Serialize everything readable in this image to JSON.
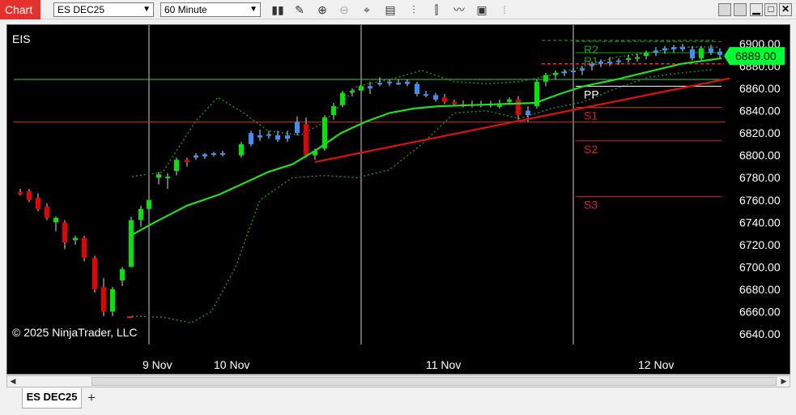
{
  "toolbar": {
    "chart_label": "Chart",
    "instrument": "ES DEC25",
    "interval": "60 Minute",
    "icons": [
      "bar-type-icon",
      "draw-pencil-icon",
      "zoom-in-icon",
      "zoom-out-icon",
      "crosshair-icon",
      "properties-icon",
      "indicators-icon",
      "strategies-icon",
      "drawing-tools-icon",
      "snapshot-icon"
    ]
  },
  "chart": {
    "symbol": "EIS",
    "copyright": "© 2025 NinjaTrader, LLC",
    "last_price": "6889.00",
    "price_ticks": [
      "6900.00",
      "6880.00",
      "6860.00",
      "6840.00",
      "6820.00",
      "6800.00",
      "6780.00",
      "6760.00",
      "6740.00",
      "6720.00",
      "6700.00",
      "6680.00",
      "6660.00",
      "6640.00"
    ],
    "date_labels": [
      "9 Nov",
      "10 Nov",
      "11 Nov",
      "12 Nov"
    ],
    "pivot_labels": {
      "r2": "R2",
      "r1": "R1",
      "pp": "PP",
      "s1": "S1",
      "s2": "S2",
      "s3": "S3"
    },
    "colors": {
      "up": "#00e600",
      "down": "#e60000",
      "neutral": "#3e8ef7",
      "sma": "#22dd22",
      "bands": "#1f8f1f",
      "trend": "#dd1111",
      "lastprice": "#00ff33"
    }
  },
  "tabs": [
    {
      "label": "ES DEC25"
    }
  ],
  "add_tab_label": "+"
}
